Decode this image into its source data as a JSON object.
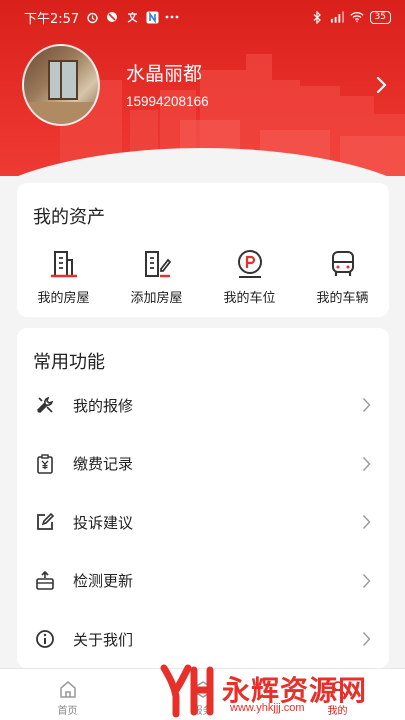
{
  "statusbar": {
    "time": "下午2:57",
    "battery": "35"
  },
  "profile": {
    "name": "水晶丽都",
    "phone": "15994208166"
  },
  "assets": {
    "title": "我的资产",
    "items": [
      {
        "label": "我的房屋",
        "icon": "building-icon"
      },
      {
        "label": "添加房屋",
        "icon": "building-edit-icon"
      },
      {
        "label": "我的车位",
        "icon": "parking-icon"
      },
      {
        "label": "我的车辆",
        "icon": "car-icon"
      }
    ]
  },
  "functions": {
    "title": "常用功能",
    "items": [
      {
        "label": "我的报修",
        "icon": "tools-icon"
      },
      {
        "label": "缴费记录",
        "icon": "payment-icon"
      },
      {
        "label": "投诉建议",
        "icon": "edit-icon"
      },
      {
        "label": "检测更新",
        "icon": "update-icon"
      },
      {
        "label": "关于我们",
        "icon": "info-icon"
      }
    ]
  },
  "tabbar": {
    "tabs": [
      {
        "label": "首页"
      },
      {
        "label": "服务"
      },
      {
        "label": "我的"
      }
    ]
  },
  "watermark": {
    "text": "永辉资源网",
    "url": "www.yhkjjj.com"
  },
  "colors": {
    "brand": "#e8302a",
    "background": "#f4f4f4"
  }
}
